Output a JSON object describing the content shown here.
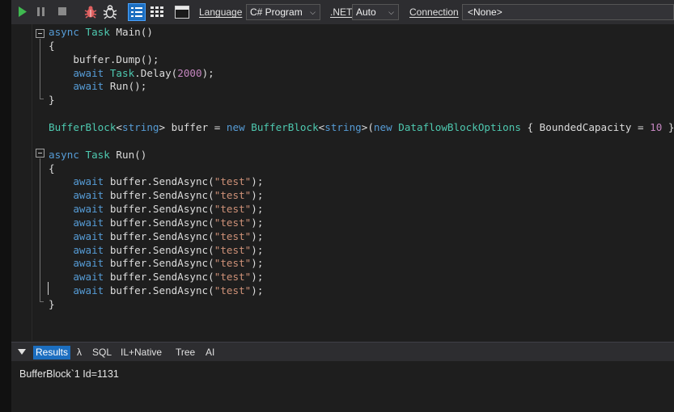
{
  "toolbar": {
    "language_label": "Language",
    "language_value": "C# Program",
    "dotnet_label": ".NET",
    "dotnet_value": "Auto",
    "connection_label": "Connection",
    "connection_value": "<None>"
  },
  "editor": {
    "lines": [
      [
        [
          "kw",
          "async "
        ],
        [
          "ty",
          "Task "
        ],
        [
          "plain",
          "Main()"
        ]
      ],
      [
        [
          "plain",
          "{"
        ]
      ],
      [
        [
          "plain",
          "    buffer.Dump();"
        ]
      ],
      [
        [
          "kw",
          "    await "
        ],
        [
          "ty",
          "Task"
        ],
        [
          "plain",
          ".Delay("
        ],
        [
          "nm2",
          "2000"
        ],
        [
          "plain",
          ");"
        ]
      ],
      [
        [
          "kw",
          "    await "
        ],
        [
          "plain",
          "Run();"
        ]
      ],
      [
        [
          "plain",
          "}"
        ]
      ],
      [],
      [
        [
          "ty",
          "BufferBlock"
        ],
        [
          "plain",
          "<"
        ],
        [
          "kw",
          "string"
        ],
        [
          "plain",
          "> buffer = "
        ],
        [
          "kw",
          "new "
        ],
        [
          "ty",
          "BufferBlock"
        ],
        [
          "plain",
          "<"
        ],
        [
          "kw",
          "string"
        ],
        [
          "plain",
          ">("
        ],
        [
          "kw",
          "new "
        ],
        [
          "ty",
          "DataflowBlockOptions"
        ],
        [
          "plain",
          " { BoundedCapacity = "
        ],
        [
          "nm2",
          "10"
        ],
        [
          "plain",
          " });"
        ]
      ],
      [],
      [
        [
          "kw",
          "async "
        ],
        [
          "ty",
          "Task "
        ],
        [
          "plain",
          "Run()"
        ]
      ],
      [
        [
          "plain",
          "{"
        ]
      ],
      [
        [
          "kw",
          "    await "
        ],
        [
          "plain",
          "buffer.SendAsync("
        ],
        [
          "st",
          "\"test\""
        ],
        [
          "plain",
          ");"
        ]
      ],
      [
        [
          "kw",
          "    await "
        ],
        [
          "plain",
          "buffer.SendAsync("
        ],
        [
          "st",
          "\"test\""
        ],
        [
          "plain",
          ");"
        ]
      ],
      [
        [
          "kw",
          "    await "
        ],
        [
          "plain",
          "buffer.SendAsync("
        ],
        [
          "st",
          "\"test\""
        ],
        [
          "plain",
          ");"
        ]
      ],
      [
        [
          "kw",
          "    await "
        ],
        [
          "plain",
          "buffer.SendAsync("
        ],
        [
          "st",
          "\"test\""
        ],
        [
          "plain",
          ");"
        ]
      ],
      [
        [
          "kw",
          "    await "
        ],
        [
          "plain",
          "buffer.SendAsync("
        ],
        [
          "st",
          "\"test\""
        ],
        [
          "plain",
          ");"
        ]
      ],
      [
        [
          "kw",
          "    await "
        ],
        [
          "plain",
          "buffer.SendAsync("
        ],
        [
          "st",
          "\"test\""
        ],
        [
          "plain",
          ");"
        ]
      ],
      [
        [
          "kw",
          "    await "
        ],
        [
          "plain",
          "buffer.SendAsync("
        ],
        [
          "st",
          "\"test\""
        ],
        [
          "plain",
          ");"
        ]
      ],
      [
        [
          "kw",
          "    await "
        ],
        [
          "plain",
          "buffer.SendAsync("
        ],
        [
          "st",
          "\"test\""
        ],
        [
          "plain",
          ");"
        ]
      ],
      [
        [
          "kw",
          "    await "
        ],
        [
          "plain",
          "buffer.SendAsync("
        ],
        [
          "st",
          "\"test\""
        ],
        [
          "plain",
          ");"
        ]
      ],
      [
        [
          "plain",
          "}"
        ]
      ]
    ]
  },
  "results": {
    "tabs": [
      "Results",
      "λ",
      "SQL",
      "IL+Native",
      "Tree",
      "AI"
    ],
    "active_tab": "Results",
    "output_text": "BufferBlock`1 Id=1131"
  },
  "colors": {
    "keyword": "#569cd6",
    "type": "#4ec9b0",
    "string": "#ce9178",
    "number": "#c586c0",
    "accent": "#1c6ec0",
    "run_green": "#3fb950"
  },
  "icons": [
    "run-icon",
    "pause-icon",
    "stop-icon",
    "bug-icon",
    "bug-step-icon",
    "grid-list-icon",
    "grid-table-icon",
    "panel-toggle-icon"
  ]
}
